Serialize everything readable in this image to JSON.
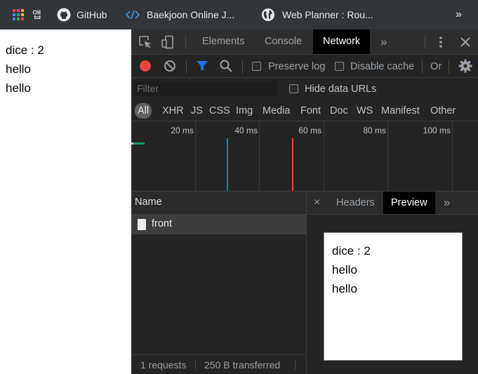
{
  "bookmarks": {
    "apps_label": "앱",
    "items": [
      "GitHub",
      "Baekjoon Online J...",
      "Web Planner : Rou..."
    ],
    "overflow": "»"
  },
  "page": {
    "lines": [
      "dice : 2",
      "hello",
      "hello"
    ]
  },
  "devtools": {
    "tabs": [
      "Elements",
      "Console",
      "Network"
    ],
    "active_tab": "Network",
    "more_tabs": "»",
    "toolbar": {
      "preserve_log": "Preserve log",
      "disable_cache": "Disable cache",
      "online_truncated": "Or"
    },
    "filter": {
      "placeholder": "Filter",
      "hide_data_urls": "Hide data URLs"
    },
    "types": [
      "All",
      "XHR",
      "JS",
      "CSS",
      "Img",
      "Media",
      "Font",
      "Doc",
      "WS",
      "Manifest",
      "Other"
    ],
    "active_type": "All",
    "overview": {
      "ticks": [
        "20 ms",
        "40 ms",
        "60 ms",
        "80 ms",
        "100 ms"
      ],
      "dom_content_loaded_color": "#1a73e8",
      "load_color": "#e8453c",
      "request_bar_color": "#0f9d58"
    },
    "list": {
      "name_header": "Name",
      "rows": [
        "front"
      ]
    },
    "details": {
      "close": "×",
      "tabs": [
        "Headers",
        "Preview"
      ],
      "active_tab": "Preview",
      "more": "»",
      "preview_lines": [
        "dice : 2",
        "hello",
        "hello"
      ]
    },
    "status": {
      "requests": "1 requests",
      "transferred": "250 B transferred"
    }
  },
  "colors": {
    "bookmark_bar": "#323639",
    "devtools_bg": "#242424",
    "record_red": "#e8453c",
    "filter_blue": "#1a73e8"
  }
}
